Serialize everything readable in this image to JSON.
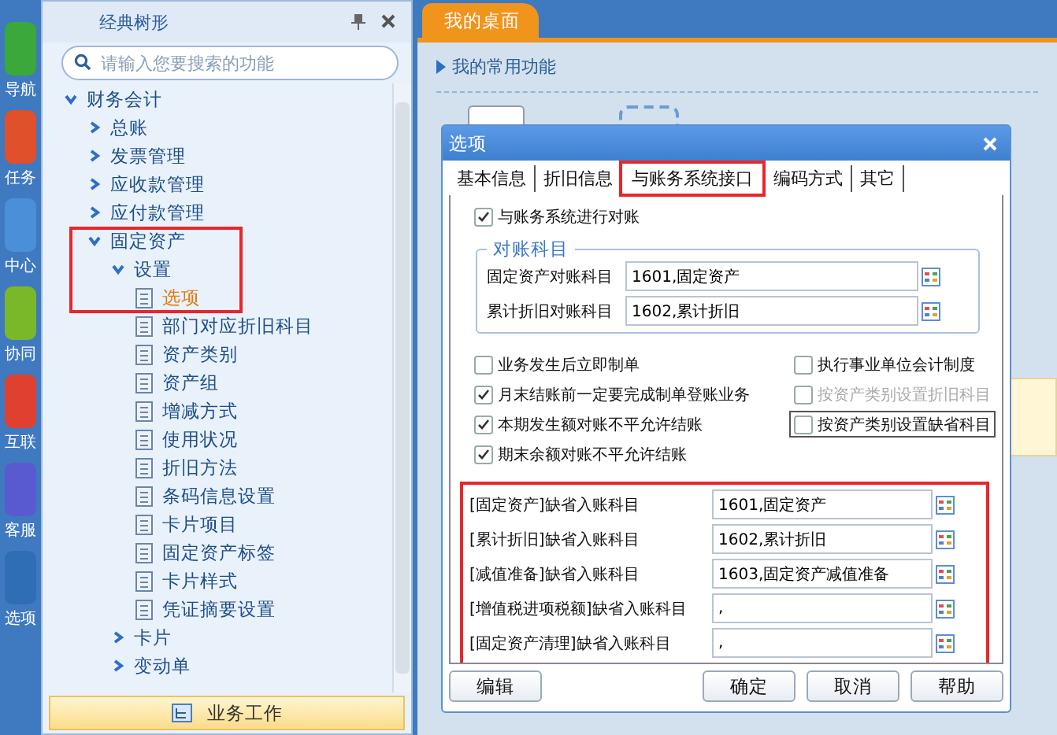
{
  "nav_strip": [
    {
      "label": "导航",
      "color": "#3aa83a"
    },
    {
      "label": "任务",
      "color": "#e0502a"
    },
    {
      "label": "中心",
      "color": "#4a8fd8"
    },
    {
      "label": "协同",
      "color": "#7ab82a"
    },
    {
      "label": "互联",
      "color": "#e04030"
    },
    {
      "label": "客服",
      "color": "#5a5ad0"
    },
    {
      "label": "选项",
      "color": "#2f6db5"
    }
  ],
  "tree_panel": {
    "title": "经典树形",
    "search": {
      "placeholder": "请输入您要搜索的功能"
    },
    "tree": [
      {
        "label": "财务会计",
        "expanded": true,
        "children": [
          {
            "label": "总账",
            "expanded": false
          },
          {
            "label": "发票管理",
            "expanded": false
          },
          {
            "label": "应收款管理",
            "expanded": false
          },
          {
            "label": "应付款管理",
            "expanded": false
          },
          {
            "label": "固定资产",
            "expanded": true,
            "highlighted": true,
            "children": [
              {
                "label": "设置",
                "expanded": true,
                "children": [
                  {
                    "label": "选项",
                    "selected": true
                  },
                  {
                    "label": "部门对应折旧科目",
                    "selected": false
                  },
                  {
                    "label": "资产类别",
                    "selected": false
                  },
                  {
                    "label": "资产组",
                    "selected": false
                  },
                  {
                    "label": "增减方式",
                    "selected": false
                  },
                  {
                    "label": "使用状况",
                    "selected": false
                  },
                  {
                    "label": "折旧方法",
                    "selected": false
                  },
                  {
                    "label": "条码信息设置",
                    "selected": false
                  },
                  {
                    "label": "卡片项目",
                    "selected": false
                  },
                  {
                    "label": "固定资产标签",
                    "selected": false
                  },
                  {
                    "label": "卡片样式",
                    "selected": false
                  },
                  {
                    "label": "凭证摘要设置",
                    "selected": false
                  }
                ]
              },
              {
                "label": "卡片",
                "expanded": false
              },
              {
                "label": "变动单",
                "expanded": false
              }
            ]
          }
        ]
      }
    ],
    "bottom_tab": "业务工作"
  },
  "workspace": {
    "tabs": [
      {
        "label": "我的桌面",
        "selected": true
      }
    ],
    "section_title": "我的常用功能"
  },
  "dialog": {
    "title": "选项",
    "tabs": [
      {
        "label": "基本信息",
        "selected": false,
        "highlighted": false
      },
      {
        "label": "折旧信息",
        "selected": false,
        "highlighted": false
      },
      {
        "label": "与账务系统接口",
        "selected": true,
        "highlighted": true
      },
      {
        "label": "编码方式",
        "selected": false,
        "highlighted": false
      },
      {
        "label": "其它",
        "selected": false,
        "highlighted": false
      }
    ],
    "reconcile": {
      "label": "与账务系统进行对账",
      "checked": true
    },
    "reconcile_accounts": {
      "title": "对账科目",
      "rows": [
        {
          "label": "固定资产对账科目",
          "value": "1601,固定资产"
        },
        {
          "label": "累计折旧对账科目",
          "value": "1602,累计折旧"
        }
      ]
    },
    "left_options": [
      {
        "label": "业务发生后立即制单",
        "checked": false
      },
      {
        "label": "月末结账前一定要完成制单登账业务",
        "checked": true
      },
      {
        "label": "本期发生额对账不平允许结账",
        "checked": true
      },
      {
        "label": "期末余额对账不平允许结账",
        "checked": true
      }
    ],
    "right_options": [
      {
        "label": "执行事业单位会计制度",
        "checked": false,
        "disabled": false,
        "focused": false
      },
      {
        "label": "按资产类别设置折旧科目",
        "checked": false,
        "disabled": true,
        "focused": false
      },
      {
        "label": "按资产类别设置缺省科目",
        "checked": false,
        "disabled": false,
        "focused": true
      }
    ],
    "default_accounts": {
      "highlighted": true,
      "rows": [
        {
          "label": "[固定资产]缺省入账科目",
          "value": "1601,固定资产"
        },
        {
          "label": "[累计折旧]缺省入账科目",
          "value": "1602,累计折旧"
        },
        {
          "label": "[减值准备]缺省入账科目",
          "value": "1603,固定资产减值准备"
        },
        {
          "label": "[增值税进项税额]缺省入账科目",
          "value": ","
        },
        {
          "label": "[固定资产清理]缺省入账科目",
          "value": ","
        }
      ]
    },
    "buttons_left": [
      "编辑"
    ],
    "buttons_right": [
      "确定",
      "取消",
      "帮助"
    ]
  }
}
